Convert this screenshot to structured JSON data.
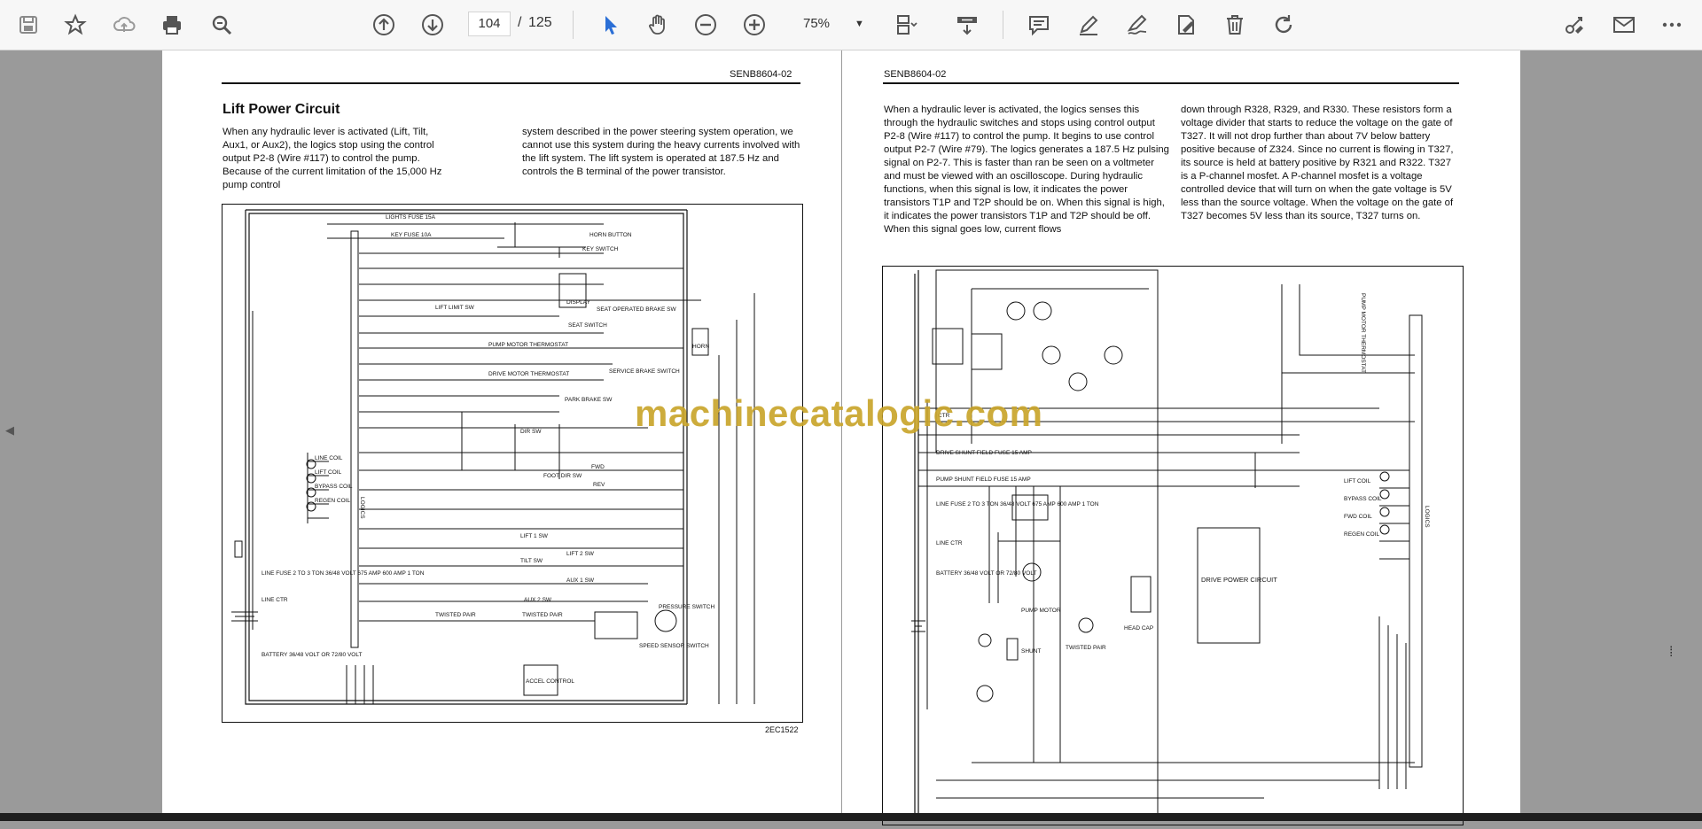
{
  "toolbar": {
    "icons": [
      "save-icon",
      "bookmark-star-icon",
      "cloud-upload-icon",
      "print-icon",
      "zoom-search-icon",
      "page-up-icon",
      "page-down-icon",
      "select-cursor-icon",
      "hand-pan-icon",
      "zoom-out-icon",
      "zoom-in-icon",
      "fit-page-icon",
      "scrolling-mode-icon",
      "comment-icon",
      "highlight-pen-icon",
      "sign-icon",
      "fill-sign-icon",
      "delete-icon",
      "rotate-icon",
      "share-link-icon",
      "email-icon",
      "more-icon"
    ],
    "page_current": "104",
    "page_separator": "/",
    "page_total": "125",
    "zoom": "75%"
  },
  "left_page": {
    "doc_code": "SENB8604-02",
    "title": "Lift Power Circuit",
    "col1": "When any hydraulic lever is activated (Lift, Tilt, Aux1, or Aux2), the logics stop using the control output P2-8 (Wire #117) to control the pump. Because of the current limitation of the 15,000 Hz pump control",
    "col2": "system described in the power steering system operation, we cannot use this system during the heavy currents involved with the lift system. The lift system is operated at 187.5 Hz and controls the B terminal of the power transistor.",
    "figure_id": "2EC1522",
    "diagram_labels": {
      "lights_fuse": "LIGHTS FUSE 15A",
      "key_fuse": "KEY FUSE 10A",
      "horn_button": "HORN BUTTON",
      "key_switch": "KEY SWITCH",
      "display": "DISPLAY",
      "lift_limit_sw": "LIFT LIMIT SW",
      "seat_operated_brake_sw": "SEAT OPERATED BRAKE SW",
      "seat_switch": "SEAT SWITCH",
      "horn": "HORN",
      "pump_motor_thermostat": "PUMP MOTOR THERMOSTAT",
      "drive_motor_thermostat": "DRIVE MOTOR THERMOSTAT",
      "service_brake_switch": "SERVICE BRAKE SWITCH",
      "park_brake_sw": "PARK BRAKE SW",
      "dir_sw": "DIR SW",
      "fwd": "FWD",
      "rev": "REV",
      "foot_dir_sw": "FOOT DIR SW",
      "line_coil": "LINE COIL",
      "lift_coil": "LIFT COIL",
      "bypass_coil": "BYPASS COIL",
      "regen_coil": "REGEN COIL",
      "logics": "LOGICS",
      "lift_1_sw": "LIFT 1 SW",
      "lift_2_sw": "LIFT 2 SW",
      "tilt_sw": "TILT SW",
      "aux_1_sw": "AUX 1 SW",
      "aux_2_sw": "AUX 2 SW",
      "twisted_pair": "TWISTED PAIR",
      "speed_sensor_switch": "SPEED SENSOR SWITCH",
      "pressure_switch": "PRESSURE SWITCH",
      "accel_control": "ACCEL CONTROL",
      "line_fuse": "LINE FUSE 2 TO 3 TON 36/48 VOLT 675 AMP 600 AMP 1 TON",
      "line_ctr": "LINE CTR",
      "battery": "BATTERY 36/48 VOLT OR 72/80 VOLT"
    }
  },
  "right_page": {
    "doc_code": "SENB8604-02",
    "col1": "When a hydraulic lever is activated, the logics senses this through the hydraulic switches and stops using control output P2-8 (Wire #117) to control the pump. It begins to use control output P2-7 (Wire #79). The logics generates a 187.5 Hz pulsing signal on P2-7. This is faster than ran be seen on a voltmeter and must be viewed with an oscilloscope. During hydraulic functions, when this signal is low, it indicates the power transistors T1P and T2P should be on. When this signal is high, it indicates the power transistors T1P and T2P should be off. When this signal goes low, current flows",
    "col2": "down through R328, R329, and R330. These resistors form a voltage divider that starts to reduce the voltage on the gate of T327. It will not drop further than about 7V below battery positive because of Z324. Since no current is flowing in T327, its source is held at battery positive by R321 and R322. T327 is a P-channel mosfet. A P-channel mosfet is a voltage controlled device that will turn on when the gate voltage is 5V less than the source voltage. When the voltage on the gate of T327 becomes 5V less than its source, T327 turns on.",
    "diagram_labels": {
      "ctr": "CTR",
      "drive_shunt_field_fuse": "DRIVE SHUNT FIELD FUSE 15 AMP",
      "pump_shunt_field_fuse": "PUMP SHUNT FIELD FUSE 15 AMP",
      "line_fuse": "LINE FUSE 2 TO 3 TON 36/48 VOLT 675 AMP 600 AMP 1 TON",
      "line_ctr": "LINE CTR",
      "battery": "BATTERY 36/48 VOLT OR 72/80 VOLT",
      "pump_motor": "PUMP MOTOR",
      "shunt": "SHUNT",
      "twisted_pair": "TWISTED PAIR",
      "head_cap": "HEAD CAP",
      "drive_power_circuit": "DRIVE POWER CIRCUIT",
      "logics": "LOGICS",
      "lift_coil": "LIFT COIL",
      "bypass_coil": "BYPASS COIL",
      "fwd_coil": "FWD COIL",
      "regen_coil": "REGEN COIL",
      "pump_motor_thermostat": "PUMP MOTOR THERMOSTAT"
    }
  },
  "watermark": "machinecatalogic.com"
}
